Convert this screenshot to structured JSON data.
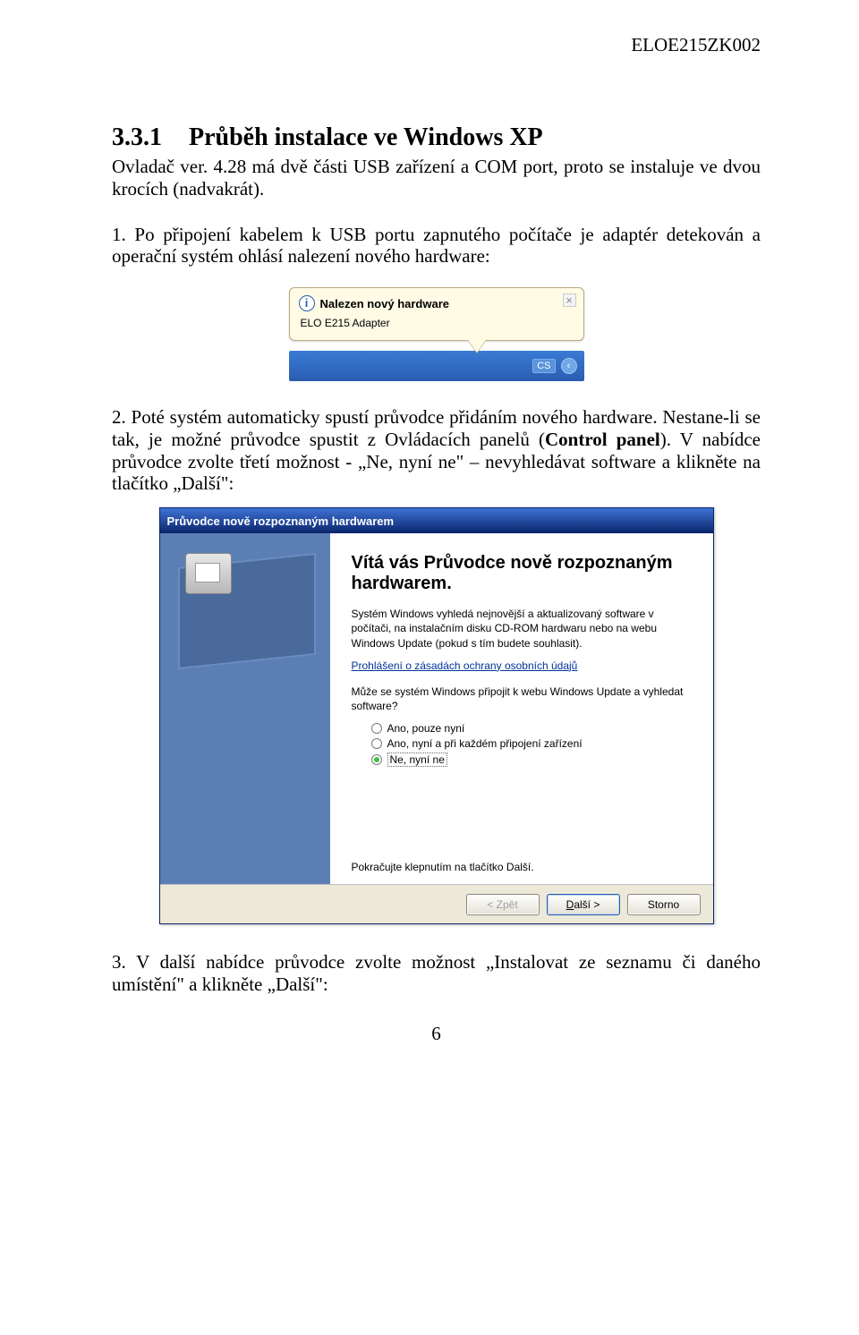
{
  "header_code": "ELOE215ZK002",
  "section": {
    "number": "3.3.1",
    "title": "Průběh instalace ve Windows XP"
  },
  "para1": "Ovladač ver. 4.28 má dvě části USB zařízení a COM port, proto se instaluje ve dvou krocích (nadvakrát).",
  "para2": "1. Po připojení kabelem k USB portu zapnutého počítače je adaptér detekován a operační systém ohlásí nalezení nového hardware:",
  "balloon": {
    "title": "Nalezen nový hardware",
    "subtitle": "ELO E215 Adapter",
    "lang": "CS"
  },
  "para3a": "2. Poté systém automaticky spustí průvodce přidáním nového hardware. Nestane-li se tak, je možné průvodce spustit z Ovládacích panelů (",
  "para3b": "Control panel",
  "para3c": "). V nabídce průvodce zvolte třetí možnost - „Ne, nyní ne\" – nevyhledávat software a klikněte na tlačítko „Další\":",
  "wizard": {
    "titlebar": "Průvodce nově rozpoznaným hardwarem",
    "heading": "Vítá vás Průvodce nově rozpoznaným hardwarem.",
    "desc": "Systém Windows vyhledá nejnovější a aktualizovaný software v počítači, na instalačním disku CD-ROM hardwaru nebo na webu Windows Update (pokud s tím budete souhlasit).",
    "privacy_link": "Prohlášení o zásadách ochrany osobních údajů",
    "question": "Může se systém Windows připojit k webu Windows Update a vyhledat software?",
    "options": [
      {
        "label": "Ano, pouze nyní",
        "checked": false,
        "selected": false
      },
      {
        "label": "Ano, nyní a při každém připojení zařízení",
        "checked": false,
        "selected": false
      },
      {
        "label": "Ne, nyní ne",
        "checked": true,
        "selected": true
      }
    ],
    "continue": "Pokračujte klepnutím na tlačítko Další.",
    "buttons": {
      "back": "< Zpět",
      "next_prefix": "D",
      "next_rest": "alší >",
      "cancel": "Storno"
    }
  },
  "para4": "3. V další nabídce průvodce zvolte možnost „Instalovat ze seznamu či daného umístění\" a klikněte „Další\":",
  "page_number": "6"
}
